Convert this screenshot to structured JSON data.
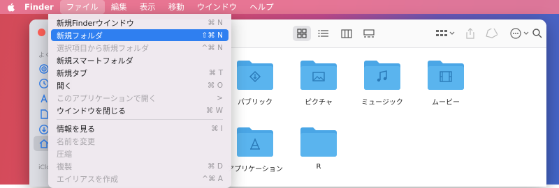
{
  "menubar": {
    "app": "Finder",
    "items": [
      "ファイル",
      "編集",
      "表示",
      "移動",
      "ウインドウ",
      "ヘルプ"
    ]
  },
  "file_menu": {
    "items": [
      {
        "label": "新規Finderウインドウ",
        "shortcut": "⌘ N",
        "state": "normal"
      },
      {
        "label": "新規フォルダ",
        "shortcut": "⇧⌘ N",
        "state": "highlighted"
      },
      {
        "label": "選択項目から新規フォルダ",
        "shortcut": "^⌘ N",
        "state": "disabled"
      },
      {
        "label": "新規スマートフォルダ",
        "shortcut": "",
        "state": "normal"
      },
      {
        "label": "新規タブ",
        "shortcut": "⌘ T",
        "state": "normal"
      },
      {
        "label": "開く",
        "shortcut": "⌘ O",
        "state": "normal"
      },
      {
        "label": "このアプリケーションで開く",
        "shortcut": ">",
        "state": "disabled"
      },
      {
        "label": "ウインドウを閉じる",
        "shortcut": "⌘ W",
        "state": "normal"
      },
      {
        "label": "情報を見る",
        "shortcut": "⌘ I",
        "state": "normal"
      },
      {
        "label": "名前を変更",
        "shortcut": "",
        "state": "disabled"
      },
      {
        "label": "圧縮",
        "shortcut": "",
        "state": "disabled"
      },
      {
        "label": "複製",
        "shortcut": "⌘ D",
        "state": "disabled"
      },
      {
        "label": "エイリアスを作成",
        "shortcut": "^⌘ A",
        "state": "disabled"
      }
    ]
  },
  "sidebar": {
    "section_favorites": "よく",
    "section_icloud": "iClo"
  },
  "folders": [
    {
      "name": "パブリック",
      "icon": "public-folder-icon"
    },
    {
      "name": "ピクチャ",
      "icon": "pictures-folder-icon"
    },
    {
      "name": "ミュージック",
      "icon": "music-folder-icon"
    },
    {
      "name": "ムービー",
      "icon": "movies-folder-icon"
    },
    {
      "name": "アプリケーション",
      "icon": "applications-folder-icon"
    },
    {
      "name": "R",
      "icon": "folder-icon"
    }
  ],
  "colors": {
    "accent": "#2f7ff0",
    "folder": "#5ab4ee",
    "close": "#ff5f57"
  }
}
